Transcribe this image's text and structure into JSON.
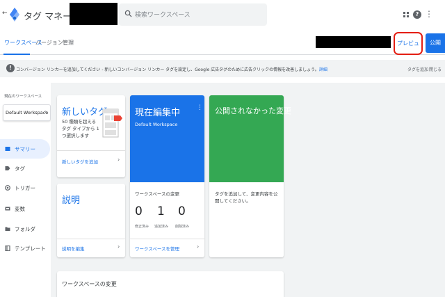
{
  "header": {
    "back_glyph": "←",
    "app_title": "タグ マネージャー",
    "search_placeholder": "検索ワークスペース",
    "help_glyph": "?",
    "more_glyph": "⋮"
  },
  "tabs": [
    {
      "label": "ワークスペース",
      "active": true
    },
    {
      "label": "バージョン",
      "active": false
    },
    {
      "label": "管理",
      "active": false
    }
  ],
  "actions": {
    "preview_label": "プレビュー",
    "publish_label": "公開"
  },
  "banner": {
    "info_glyph": "!",
    "text": "コンバージョン リンカーを追加してください - 新しいコンバージョン リンカー タグを設定し、Google 広告タグのために広告クリックの情報を改善しましょう。",
    "link": "詳細",
    "add_tag": "タグを追加",
    "close": "閉じる"
  },
  "sidebar": {
    "workspace_label": "現在のワークスペース",
    "workspace_name": "Default Workspace",
    "items": [
      {
        "label": "サマリー",
        "icon": "summary-icon",
        "selected": true
      },
      {
        "label": "タグ",
        "icon": "tag-icon",
        "selected": false
      },
      {
        "label": "トリガー",
        "icon": "trigger-icon",
        "selected": false
      },
      {
        "label": "変数",
        "icon": "variable-icon",
        "selected": false
      },
      {
        "label": "フォルダ",
        "icon": "folder-icon",
        "selected": false
      },
      {
        "label": "テンプレート",
        "icon": "template-icon",
        "selected": false
      }
    ]
  },
  "cards": {
    "new_tag": {
      "title": "新しいタグ",
      "body": "50 種類を超えるタグ タイプから 1 つ選択します",
      "footer": "新しいタグを追加"
    },
    "editing": {
      "title": "現在編集中",
      "workspace": "Default Workspace",
      "changes_title": "ワークスペースの変更",
      "stats": [
        {
          "value": "0",
          "label": "修正済み"
        },
        {
          "value": "1",
          "label": "追加済み"
        },
        {
          "value": "0",
          "label": "削除済み"
        }
      ],
      "footer": "ワークスペースを管理"
    },
    "unpublished": {
      "title": "公開されなかった変更",
      "body": "タグを追加して、変更内容を公開してください。"
    },
    "description": {
      "title": "説明",
      "footer": "説明を編集"
    },
    "workspace_changes": {
      "title": "ワークスペースの変更"
    }
  },
  "colors": {
    "accent": "#1a73e8",
    "editing_bg": "#1a73e8",
    "unpublished_bg": "#34a853",
    "highlight": "#e41e13"
  }
}
